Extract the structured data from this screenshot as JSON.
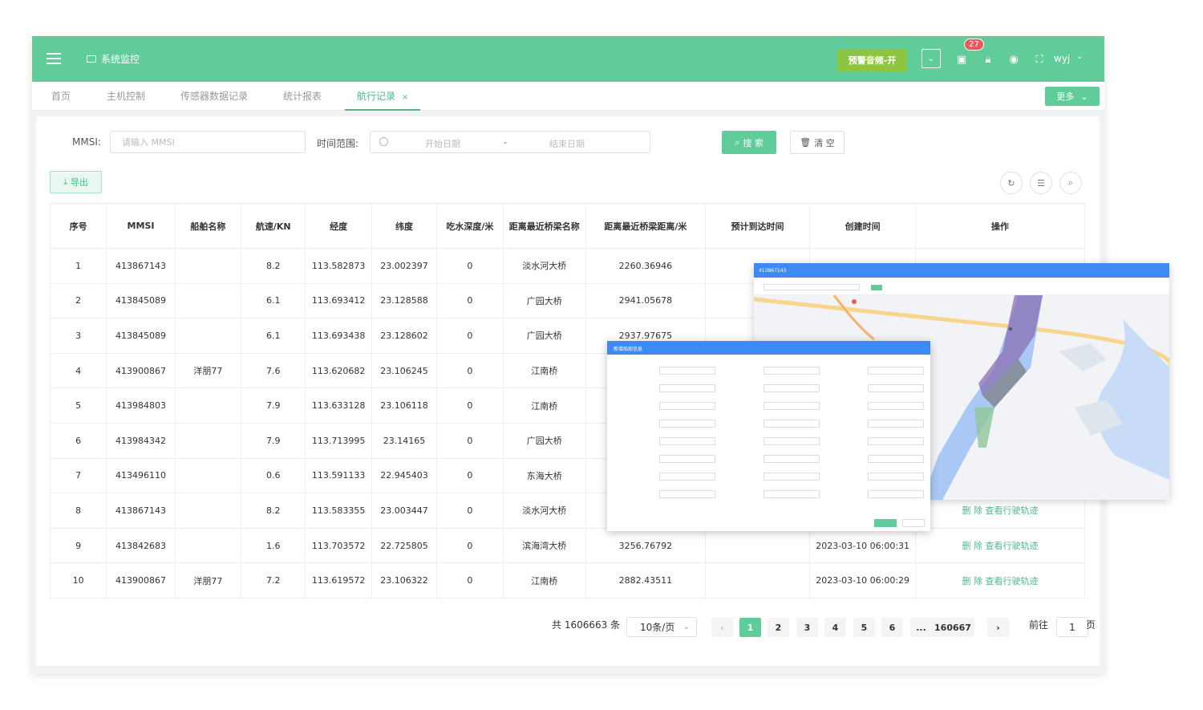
{
  "header": {
    "system_title": "系统监控",
    "warning_button": "预警音频-开",
    "notification_count": "27",
    "user_name": "wyj"
  },
  "tabs": [
    {
      "label": "首页"
    },
    {
      "label": "主机控制"
    },
    {
      "label": "传感器数据记录"
    },
    {
      "label": "统计报表"
    },
    {
      "label": "航行记录",
      "active": true
    }
  ],
  "more_button": "更多",
  "filters": {
    "mmsi_label": "MMSI:",
    "mmsi_placeholder": "请输入 MMSI",
    "time_label": "时间范围:",
    "start_placeholder": "开始日期",
    "range_sep": "-",
    "end_placeholder": "结束日期",
    "search_button": "搜 索",
    "clear_button": "清 空",
    "export_button": "导出"
  },
  "table": {
    "headers": [
      "序号",
      "MMSI",
      "船舶名称",
      "航速/KN",
      "经度",
      "纬度",
      "吃水深度/米",
      "距离最近桥梁名称",
      "距离最近桥梁距离/米",
      "预计到达时间",
      "创建时间",
      "操作"
    ],
    "rows": [
      [
        "1",
        "413867143",
        "",
        "8.2",
        "113.582873",
        "23.002397",
        "0",
        "淡水河大桥",
        "2260.36946",
        "",
        "",
        ""
      ],
      [
        "2",
        "413845089",
        "",
        "6.1",
        "113.693412",
        "23.128588",
        "0",
        "广园大桥",
        "2941.05678",
        "",
        "",
        ""
      ],
      [
        "3",
        "413845089",
        "",
        "6.1",
        "113.693438",
        "23.128602",
        "0",
        "广园大桥",
        "2937.97675",
        "",
        "",
        ""
      ],
      [
        "4",
        "413900867",
        "洋朋77",
        "7.6",
        "113.620682",
        "23.106245",
        "0",
        "江南桥",
        "",
        "",
        "",
        ""
      ],
      [
        "5",
        "413984803",
        "",
        "7.9",
        "113.633128",
        "23.106118",
        "0",
        "江南桥",
        "",
        "",
        "",
        ""
      ],
      [
        "6",
        "413984342",
        "",
        "7.9",
        "113.713995",
        "23.14165",
        "0",
        "广园大桥",
        "",
        "",
        "",
        ""
      ],
      [
        "7",
        "413496110",
        "",
        "0.6",
        "113.591133",
        "22.945403",
        "0",
        "东海大桥",
        "",
        "",
        "",
        ""
      ],
      [
        "8",
        "413867143",
        "",
        "8.2",
        "113.583355",
        "23.003447",
        "0",
        "淡水河大桥",
        "",
        "",
        "",
        "删 除  查看行驶轨迹"
      ],
      [
        "9",
        "413842683",
        "",
        "1.6",
        "113.703572",
        "22.725805",
        "0",
        "滨海湾大桥",
        "3256.76792",
        "",
        "2023-03-10 06:00:31",
        "删 除  查看行驶轨迹"
      ],
      [
        "10",
        "413900867",
        "洋朋77",
        "7.2",
        "113.619572",
        "23.106322",
        "0",
        "江南桥",
        "2882.43511",
        "",
        "2023-03-10 06:00:29",
        "删 除  查看行驶轨迹"
      ]
    ]
  },
  "pagination": {
    "total_text": "共 1606663 条",
    "page_size": "10条/页",
    "pages": [
      "1",
      "2",
      "3",
      "4",
      "5",
      "6",
      "...",
      "160667"
    ],
    "goto_label": "前往",
    "goto_value": "1",
    "page_unit": "页"
  },
  "overlays": {
    "map_title": "413867143",
    "form_title": "新增船舶信息"
  },
  "colors": {
    "primary": "#5fcc9a",
    "warning_button": "#8cc63f",
    "badge": "#e35b5b",
    "overlay_header": "#3d8bf2"
  }
}
